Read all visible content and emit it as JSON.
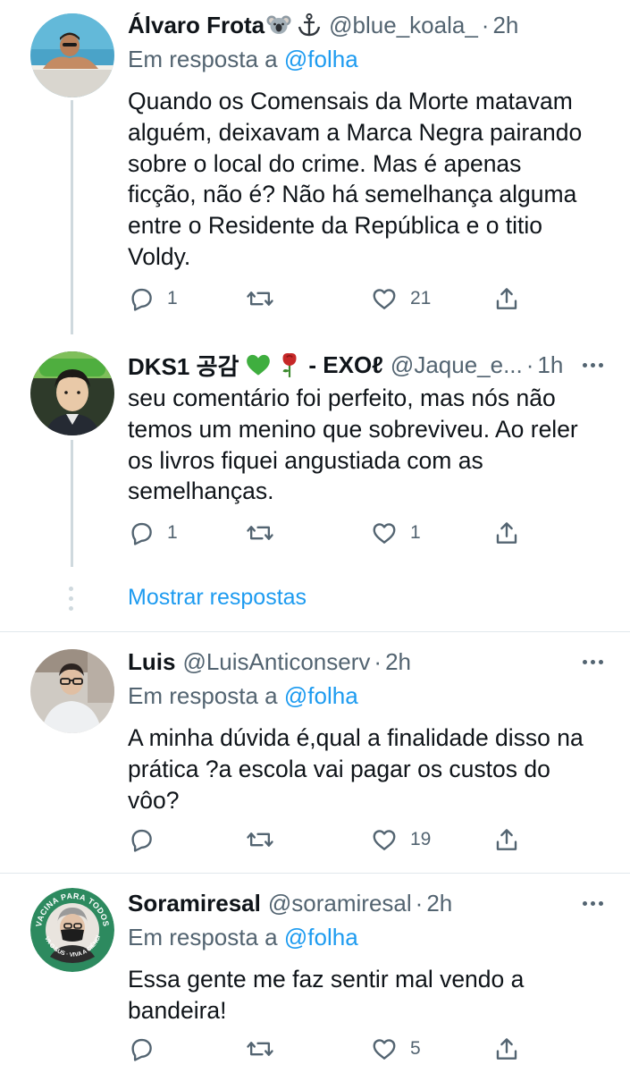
{
  "tweets": [
    {
      "name": "Álvaro Frota",
      "name_emojis": [
        "koala-emoji",
        "anchor-emoji"
      ],
      "handle": "@blue_koala_",
      "time": "2h",
      "reply_prefix": "Em resposta a",
      "reply_to": "@folha",
      "text": "Quando os Comensais da Morte matavam\nalguém, deixavam a Marca Negra pairando\nsobre o local do crime. Mas é apenas\nficção, não é? Não há semelhança alguma\nentre o Residente da República e o titio\nVoldy.",
      "replies": "1",
      "retweets": "",
      "likes": "21"
    },
    {
      "name": "DKS1 공감",
      "name_suffix": "- EXOℓ",
      "name_emojis": [
        "green-heart-emoji",
        "rose-emoji"
      ],
      "handle": "@Jaque_e...",
      "time": "1h",
      "text": "seu comentário foi perfeito, mas nós não\ntemos um menino que sobreviveu. Ao reler\nos livros fiquei angustiada com as\nsemelhanças.",
      "replies": "1",
      "retweets": "",
      "likes": "1"
    },
    {
      "name": "Luis",
      "handle": "@LuisAnticonserv",
      "time": "2h",
      "reply_prefix": "Em resposta a",
      "reply_to": "@folha",
      "text": "A minha dúvida é,qual a finalidade disso na\nprática ?a escola vai pagar os custos do\nvôo?",
      "replies": "",
      "retweets": "",
      "likes": "19"
    },
    {
      "name": "Soramiresal",
      "handle": "@soramiresal",
      "time": "2h",
      "reply_prefix": "Em resposta a",
      "reply_to": "@folha",
      "text": "Essa gente me faz sentir mal vendo a\nbandeira!",
      "replies": "",
      "retweets": "",
      "likes": "5",
      "avatar_text_top": "VACINA PARA TODOS",
      "avatar_text_bottom": "VIVA O SUS · VIVA A CIÊNCIA"
    }
  ],
  "show_replies": "Mostrar respostas",
  "colors": {
    "link": "#1d9bf0",
    "secondary": "#536471",
    "text": "#0f1419",
    "thread_line": "#cfd9de",
    "divider": "#e1e8ed"
  }
}
